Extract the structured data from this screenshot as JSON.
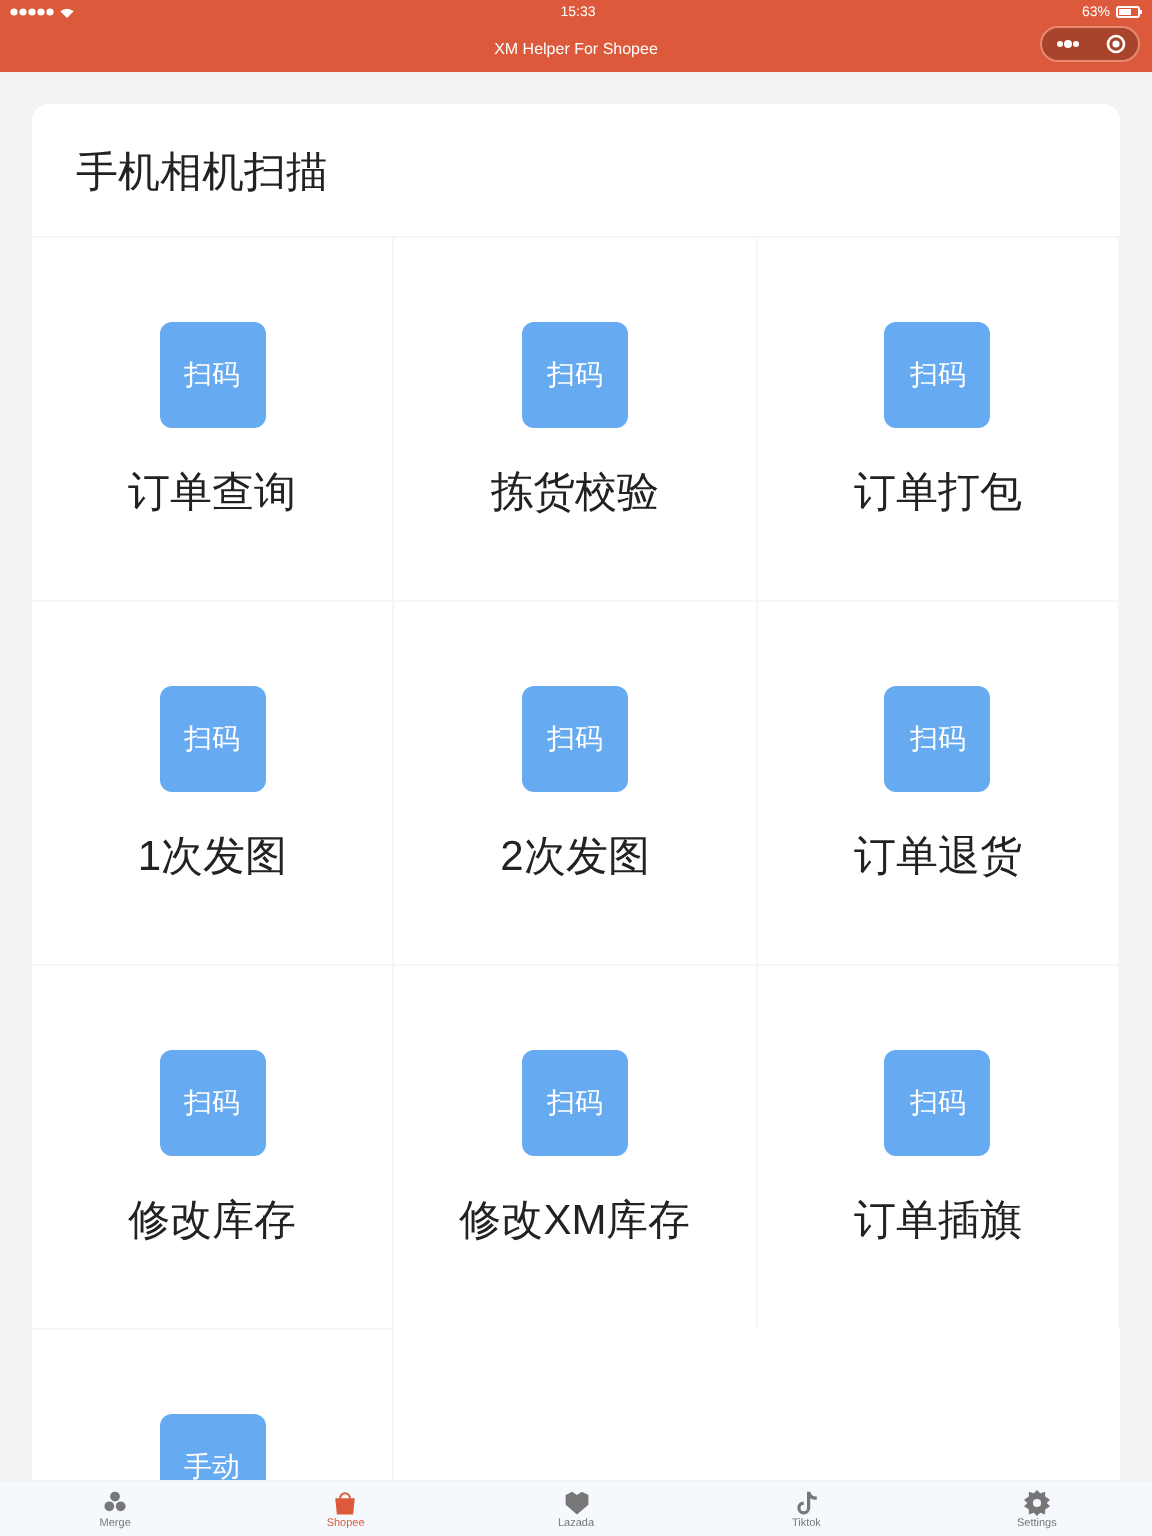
{
  "status_bar": {
    "time": "15:33",
    "battery": "63%"
  },
  "header": {
    "title": "XM Helper For Shopee"
  },
  "card": {
    "title": "手机相机扫描",
    "items": [
      {
        "button": "扫码",
        "label": "订单查询"
      },
      {
        "button": "扫码",
        "label": "拣货校验"
      },
      {
        "button": "扫码",
        "label": "订单打包"
      },
      {
        "button": "扫码",
        "label": "1次发图"
      },
      {
        "button": "扫码",
        "label": "2次发图"
      },
      {
        "button": "扫码",
        "label": "订单退货"
      },
      {
        "button": "扫码",
        "label": "修改库存"
      },
      {
        "button": "扫码",
        "label": "修改XM库存"
      },
      {
        "button": "扫码",
        "label": "订单插旗"
      },
      {
        "button": "手动"
      }
    ]
  },
  "tab_bar": [
    {
      "kind": "merge",
      "label": "Merge",
      "selected": false
    },
    {
      "kind": "shopee",
      "label": "Shopee",
      "selected": true
    },
    {
      "kind": "lazada",
      "label": "Lazada",
      "selected": false
    },
    {
      "kind": "tiktok",
      "label": "Tiktok",
      "selected": false
    },
    {
      "kind": "settings",
      "label": "Settings",
      "selected": false
    }
  ]
}
